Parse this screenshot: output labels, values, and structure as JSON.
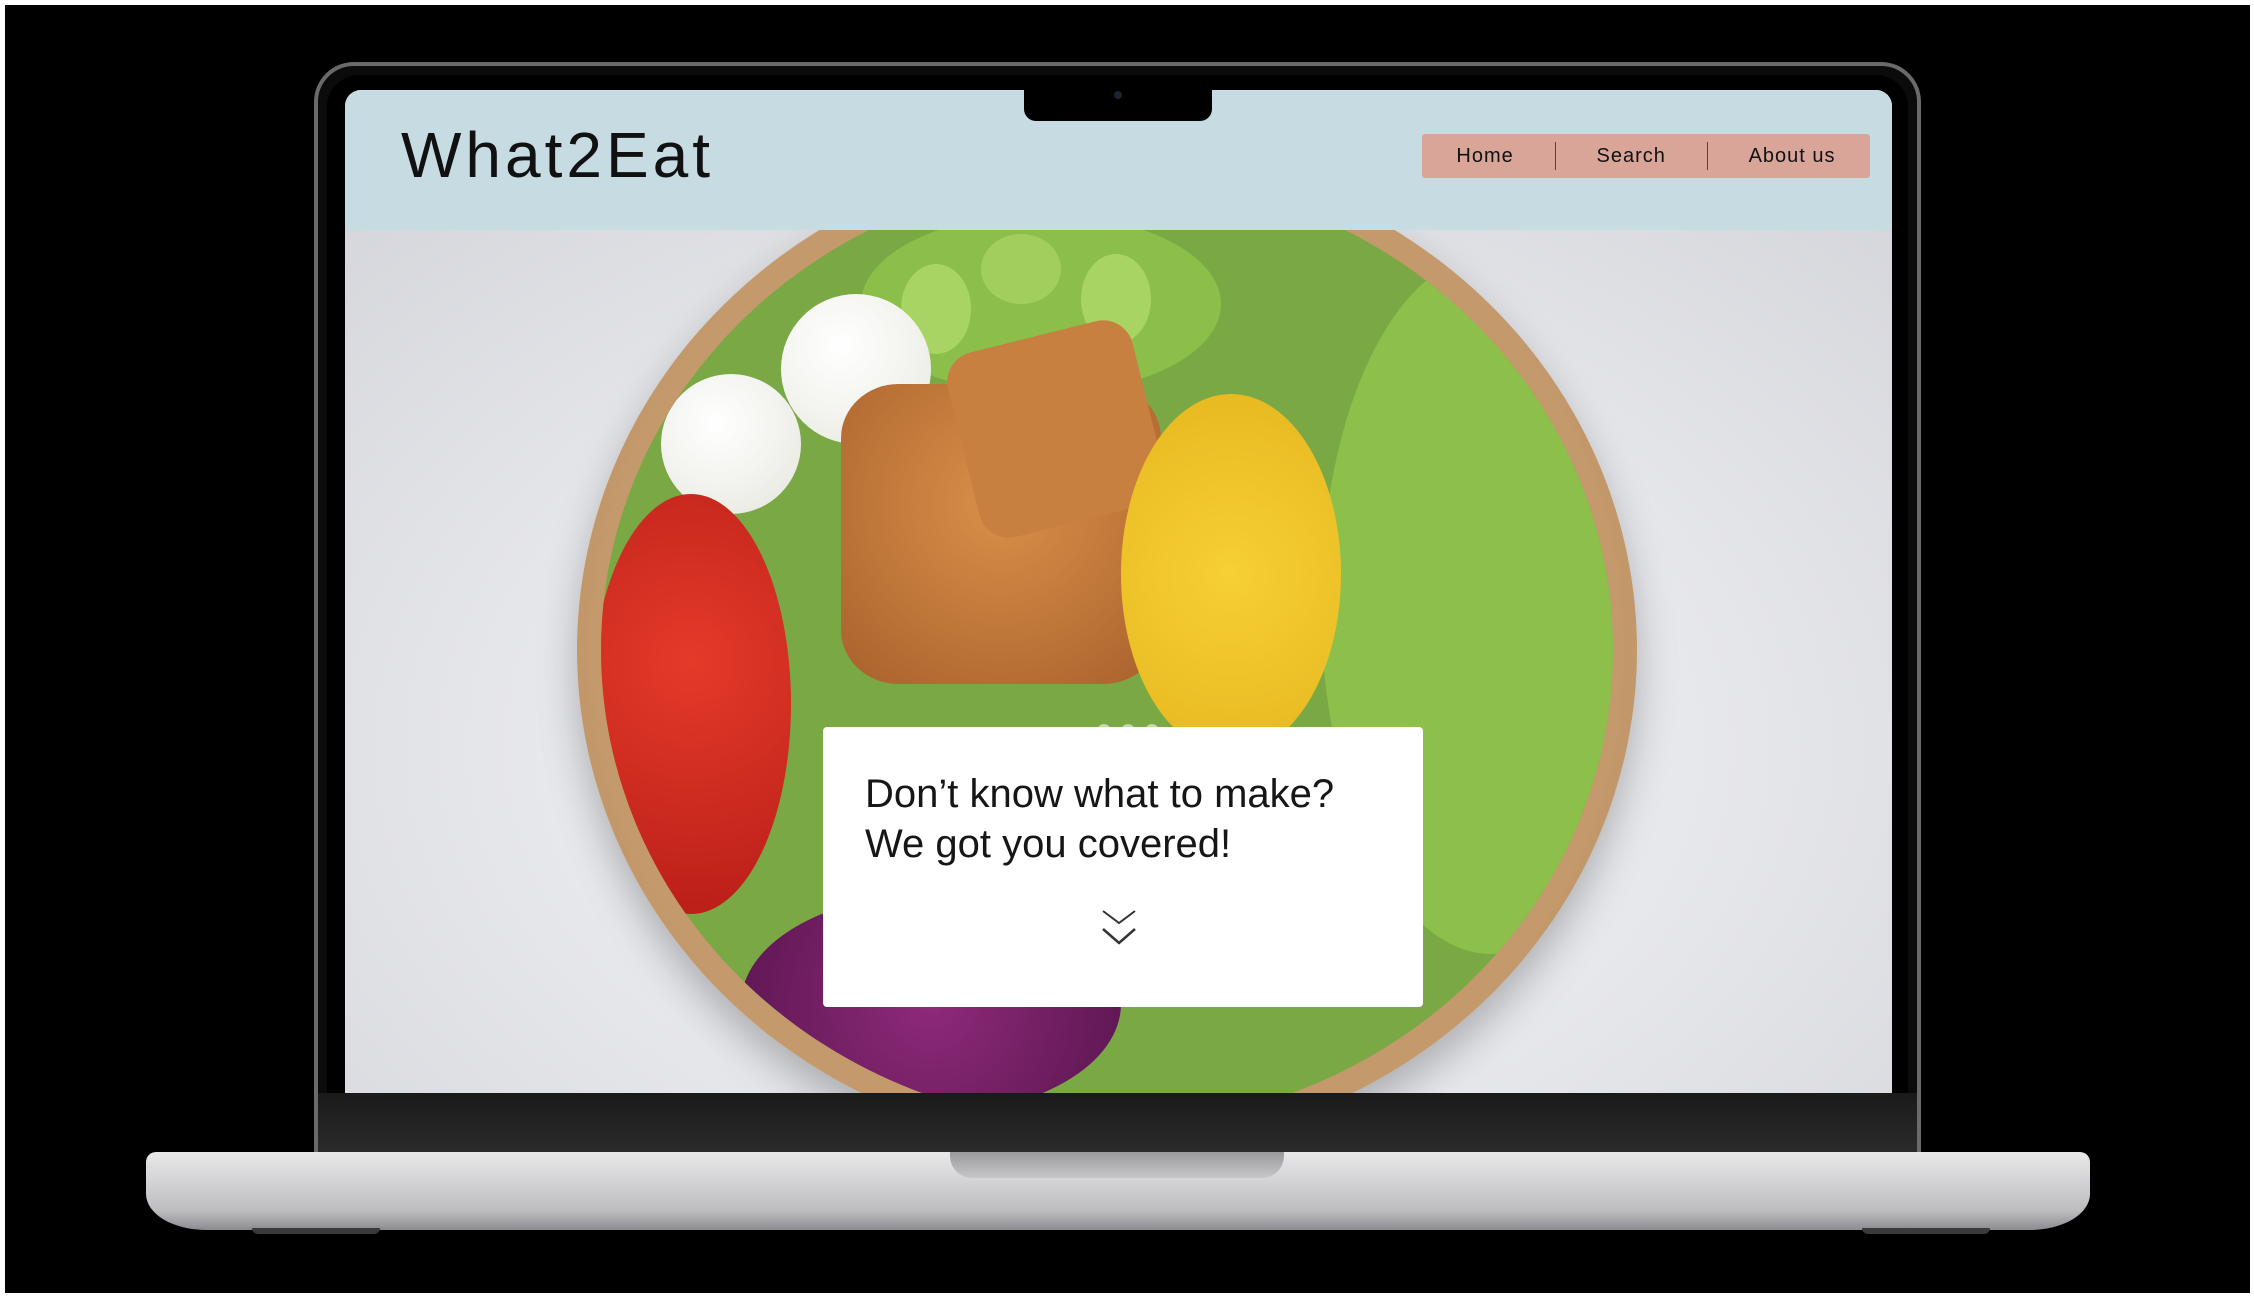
{
  "site": {
    "logo": "What2Eat",
    "nav": [
      {
        "label": "Home"
      },
      {
        "label": "Search"
      },
      {
        "label": "About us"
      }
    ]
  },
  "hero": {
    "tagline_line1": "Don’t know what to make?",
    "tagline_line2": "We got you covered!",
    "scroll_icon": "double-chevron-down-icon",
    "carousel_dots": 3
  },
  "colors": {
    "header_bg": "#c7dbe2",
    "nav_bg": "#d9a598",
    "card_bg": "#ffffff",
    "backdrop": "#000000"
  }
}
